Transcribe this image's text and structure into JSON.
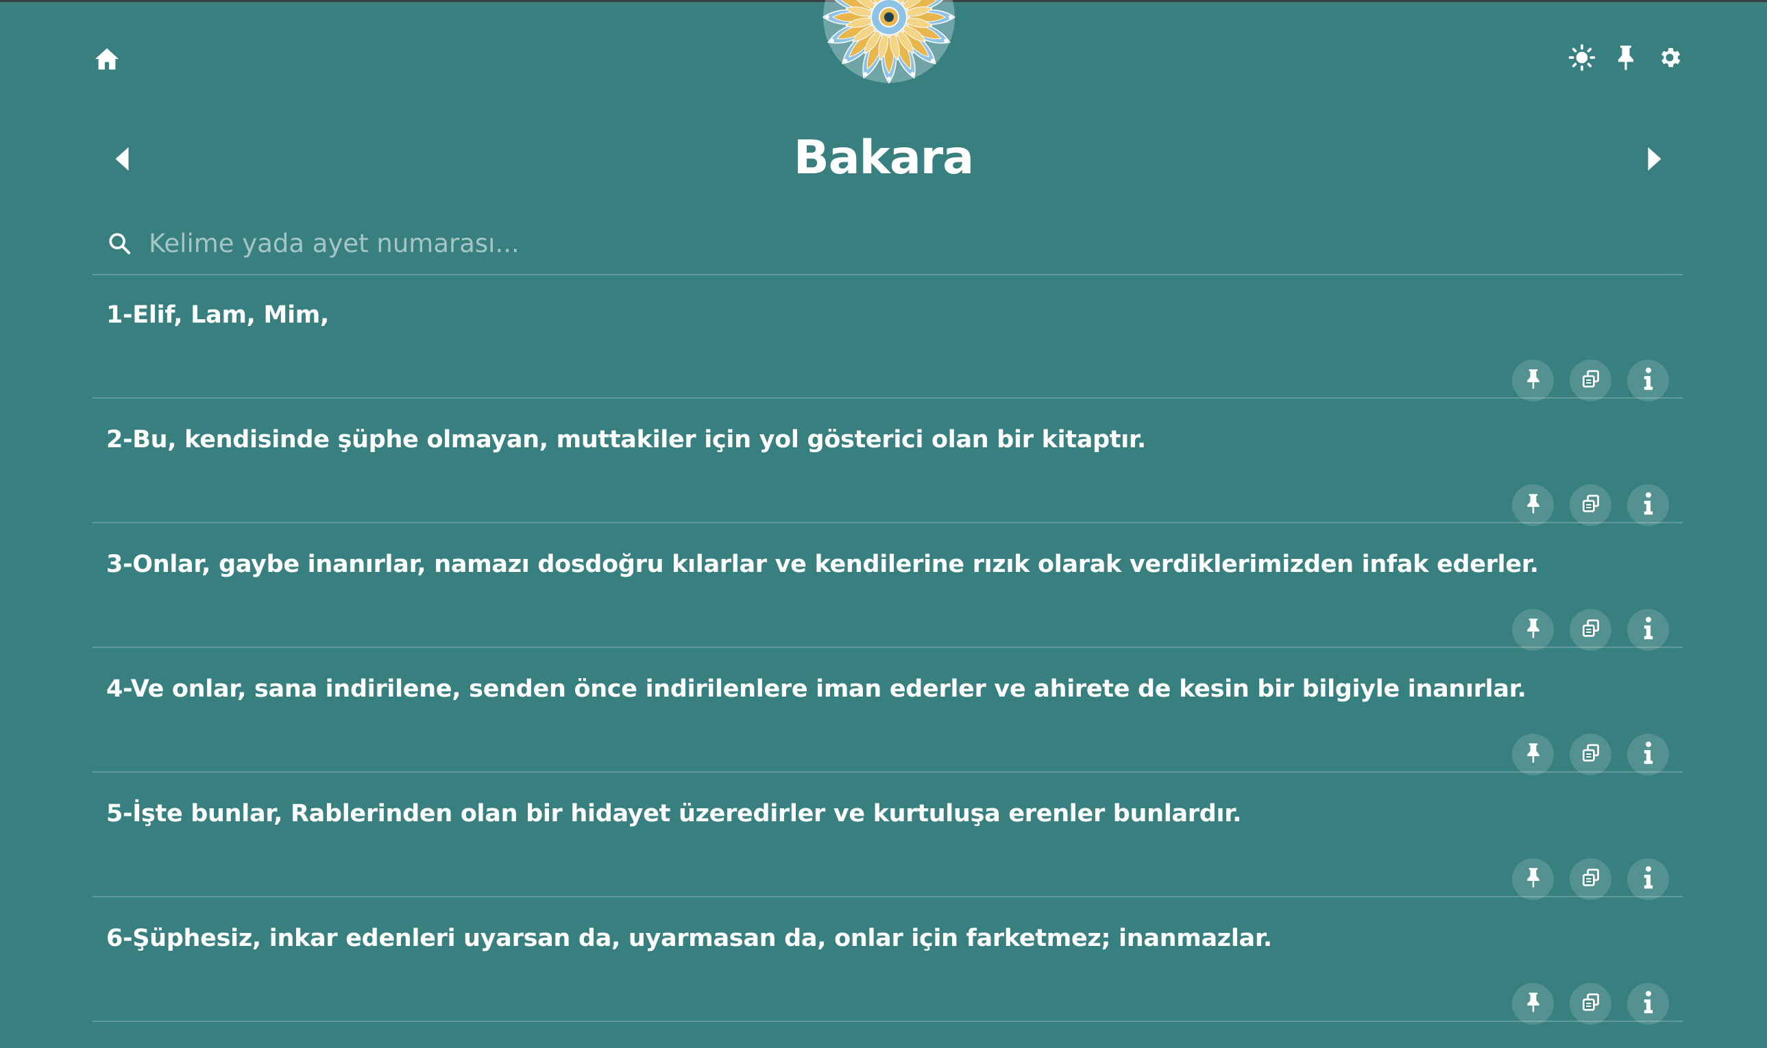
{
  "header": {
    "home_icon": "home-icon",
    "logo": "mandala-logo",
    "theme_icon": "sun-icon",
    "pin_icon": "pin-icon",
    "settings_icon": "gear-icon"
  },
  "surah": {
    "title": "Bakara",
    "prev_icon": "caret-left-icon",
    "next_icon": "caret-right-icon"
  },
  "search": {
    "placeholder": "Kelime yada ayet numarası..."
  },
  "verses": [
    {
      "text": "1-Elif, Lam, Mim,"
    },
    {
      "text": "2-Bu, kendisinde şüphe olmayan, muttakiler için yol gösterici olan bir kitaptır."
    },
    {
      "text": "3-Onlar, gaybe inanırlar, namazı dosdoğru kılarlar ve kendilerine rızık olarak verdiklerimizden infak ederler."
    },
    {
      "text": "4-Ve onlar, sana indirilene, senden önce indirilenlere iman ederler ve ahirete de kesin bir bilgiyle inanırlar."
    },
    {
      "text": "5-İşte bunlar, Rablerinden olan bir hidayet üzeredirler ve kurtuluşa erenler bunlardır."
    },
    {
      "text": "6-Şüphesiz, inkar edenleri uyarsan da, uyarmasan da, onlar için farketmez; inanmazlar."
    }
  ],
  "verse_actions": [
    "pin-icon",
    "copy-icon",
    "info-icon"
  ],
  "colors": {
    "background": "#387f7f",
    "text": "#ffffff",
    "logo_gold": "#e8b64c",
    "logo_blue": "#8ec3e6"
  }
}
